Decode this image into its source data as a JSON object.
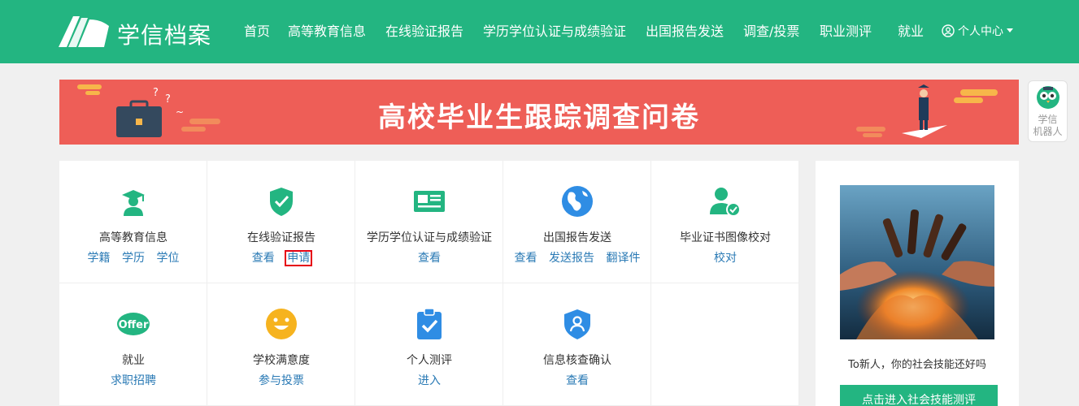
{
  "header": {
    "brand": "学信档案",
    "nav": [
      {
        "label": "首页"
      },
      {
        "label": "高等教育信息"
      },
      {
        "label": "在线验证报告"
      },
      {
        "label": "学历学位认证与成绩验证"
      },
      {
        "label": "出国报告发送"
      },
      {
        "label": "调查/投票"
      },
      {
        "label": "职业测评"
      },
      {
        "label": "就业"
      }
    ],
    "user_menu": "个人中心"
  },
  "banner": {
    "title": "高校毕业生跟踪调查问卷"
  },
  "robot": {
    "label_line1": "学信",
    "label_line2": "机器人"
  },
  "services": [
    {
      "title": "高等教育信息",
      "icon": "graduate-icon",
      "links": [
        "学籍",
        "学历",
        "学位"
      ]
    },
    {
      "title": "在线验证报告",
      "icon": "shield-check-icon",
      "links": [
        "查看",
        "申请"
      ]
    },
    {
      "title": "学历学位认证与成绩验证",
      "icon": "id-card-icon",
      "links": [
        "查看"
      ]
    },
    {
      "title": "出国报告发送",
      "icon": "globe-icon",
      "links": [
        "查看",
        "发送报告",
        "翻译件"
      ]
    },
    {
      "title": "毕业证书图像校对",
      "icon": "user-check-icon",
      "links": [
        "校对"
      ]
    },
    {
      "title": "就业",
      "icon": "offer-icon",
      "icon_text": "Offer",
      "links": [
        "求职招聘"
      ]
    },
    {
      "title": "学校满意度",
      "icon": "smile-icon",
      "links": [
        "参与投票"
      ]
    },
    {
      "title": "个人测评",
      "icon": "clipboard-check-icon",
      "links": [
        "进入"
      ]
    },
    {
      "title": "信息核查确认",
      "icon": "user-shield-icon",
      "links": [
        "查看"
      ]
    }
  ],
  "side": {
    "caption": "To新人，你的社会技能还好吗",
    "button": "点击进入社会技能测评"
  },
  "colors": {
    "brand_green": "#23b581",
    "banner_red": "#ee5e57",
    "link_blue": "#2a7ab5",
    "highlight_red": "#e60012"
  }
}
